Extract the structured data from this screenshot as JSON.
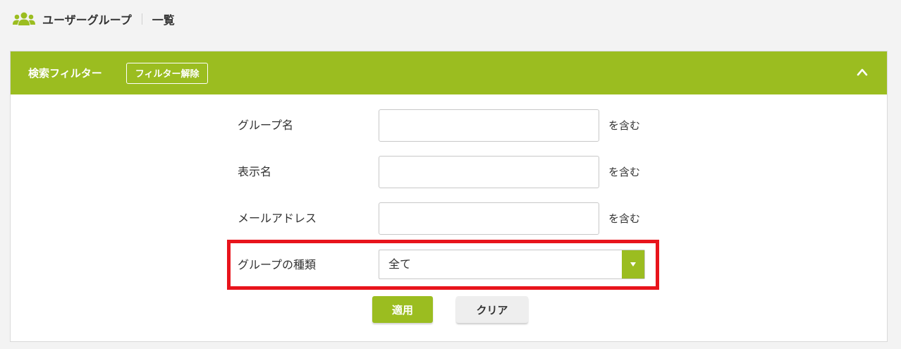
{
  "header": {
    "icon": "user-group-icon",
    "title": "ユーザーグループ",
    "subtitle": "一覧"
  },
  "filter_panel": {
    "title": "検索フィルター",
    "clear_filter_label": "フィルター解除",
    "collapse_icon": "chevron-up-icon",
    "accent_color": "#9bbd20"
  },
  "form": {
    "group_name": {
      "label": "グループ名",
      "value": "",
      "suffix": "を含む"
    },
    "display_name": {
      "label": "表示名",
      "value": "",
      "suffix": "を含む"
    },
    "email": {
      "label": "メールアドレス",
      "value": "",
      "suffix": "を含む"
    },
    "group_type": {
      "label": "グループの種類",
      "selected": "全て"
    }
  },
  "buttons": {
    "apply_label": "適用",
    "clear_label": "クリア"
  },
  "highlight_color": "#e8141c"
}
